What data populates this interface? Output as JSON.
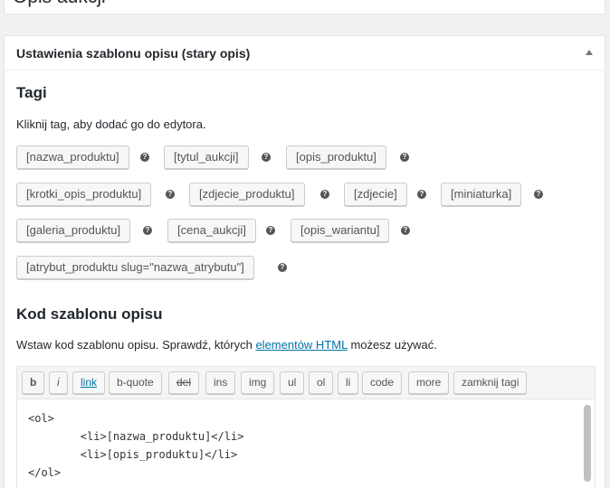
{
  "top_box": {
    "title": "Opis aukcji"
  },
  "panel": {
    "title": "Ustawienia szablonu opisu (stary opis)",
    "tags_section": {
      "heading": "Tagi",
      "description": "Kliknij tag, aby dodać go do edytora.",
      "help_glyph": "?",
      "tags": [
        "[nazwa_produktu]",
        "[tytul_aukcji]",
        "[opis_produktu]",
        "[krotki_opis_produktu]",
        "[zdjecie_produktu]",
        "[zdjecie]",
        "[miniaturka]",
        "[galeria_produktu]",
        "[cena_aukcji]",
        "[opis_wariantu]",
        "[atrybut_produktu slug=\"nazwa_atrybutu\"]"
      ]
    },
    "code_section": {
      "heading": "Kod szablonu opisu",
      "desc_before": "Wstaw kod szablonu opisu. Sprawdź, których ",
      "desc_link": "elementów HTML",
      "desc_after": " możesz używać."
    },
    "editor": {
      "toolbar": [
        "b",
        "i",
        "link",
        "b-quote",
        "del",
        "ins",
        "img",
        "ul",
        "ol",
        "li",
        "code",
        "more",
        "zamknij tagi"
      ],
      "code_lines": [
        "<ol>",
        "        <li>[nazwa_produktu]</li>",
        "        <li>[opis_produktu]</li>",
        "</ol>"
      ]
    }
  },
  "colors": {
    "link": "#0073aa",
    "accent": "#23282d"
  }
}
